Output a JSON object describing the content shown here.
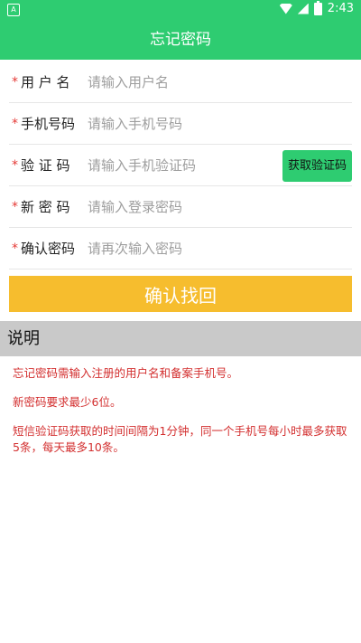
{
  "status_bar": {
    "time": "2:43",
    "left_indicator": "A"
  },
  "app_bar": {
    "title": "忘记密码"
  },
  "form": {
    "required_mark": "*",
    "fields": [
      {
        "label": "用 户 名",
        "placeholder": "请输入用户名"
      },
      {
        "label": "手机号码",
        "placeholder": "请输入手机号码"
      },
      {
        "label": "验 证 码",
        "placeholder": "请输入手机验证码",
        "button": "获取验证码"
      },
      {
        "label": "新 密 码",
        "placeholder": "请输入登录密码"
      },
      {
        "label": "确认密码",
        "placeholder": "请再次输入密码"
      }
    ],
    "submit_label": "确认找回"
  },
  "notes": {
    "title": "说明",
    "items": [
      "忘记密码需输入注册的用户名和备案手机号。",
      "新密码要求最少6位。",
      "短信验证码获取的时间间隔为1分钟，同一个手机号每小时最多获取5条，每天最多10条。"
    ]
  },
  "colors": {
    "primary": "#2ecc71",
    "accent": "#f6bd2e",
    "warning": "#d32f2f"
  },
  "icons": [
    "app-indicator-icon",
    "wifi-icon",
    "signal-icon",
    "battery-icon"
  ]
}
